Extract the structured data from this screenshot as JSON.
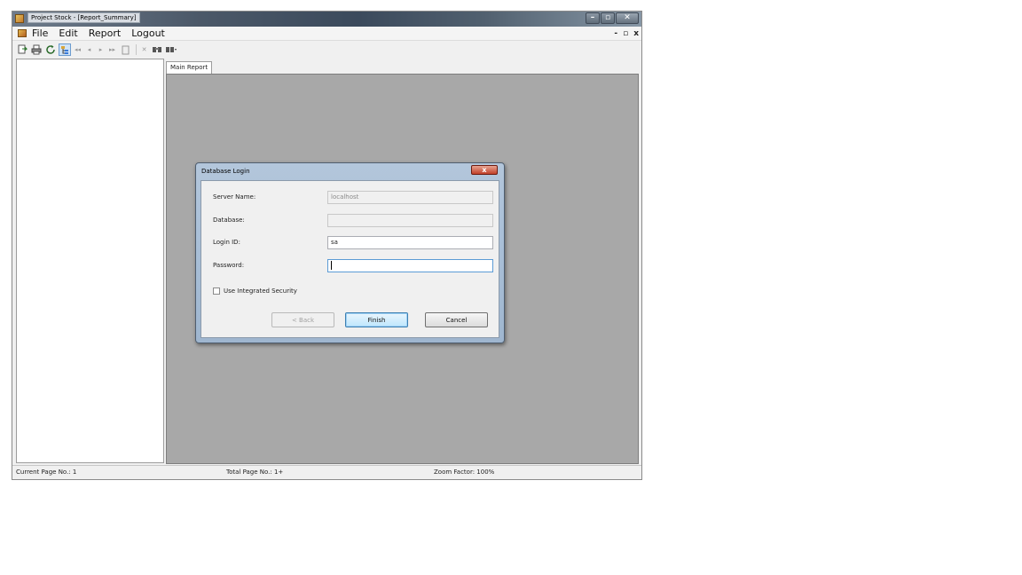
{
  "window": {
    "title": "Project Stock - [Report_Summary]",
    "controls": [
      "–",
      "▫",
      "✕"
    ]
  },
  "menubar": {
    "items": [
      "File",
      "Edit",
      "Report",
      "Logout"
    ],
    "mdi_controls": [
      "-",
      "▫",
      "x"
    ]
  },
  "toolbar": {
    "icons": [
      "export-icon",
      "print-icon",
      "refresh-icon",
      "toggle-group-tree-icon",
      "first-page-icon",
      "previous-page-icon",
      "next-page-icon",
      "last-page-icon",
      "goto-page-icon",
      "close-view-icon",
      "search-icon",
      "zoom-icon"
    ]
  },
  "tabs": [
    "Main Report"
  ],
  "dialog": {
    "title": "Database Login",
    "close_label": "x",
    "fields": {
      "server_label": "Server Name:",
      "server_value": "localhost",
      "database_label": "Database:",
      "database_value": "",
      "login_label": "Login ID:",
      "login_value": "sa",
      "password_label": "Password:",
      "password_value": ""
    },
    "checkbox_label": "Use Integrated Security",
    "checkbox_checked": false,
    "buttons": {
      "back": "< Back",
      "finish": "Finish",
      "cancel": "Cancel"
    }
  },
  "statusbar": {
    "current_page": "Current Page No.: 1",
    "total_page": "Total Page No.: 1+",
    "zoom": "Zoom Factor: 100%"
  },
  "colors": {
    "report_background": "#a8a8a8",
    "dialog_frame": "#aac0d8",
    "close_button": "#c2412a"
  }
}
